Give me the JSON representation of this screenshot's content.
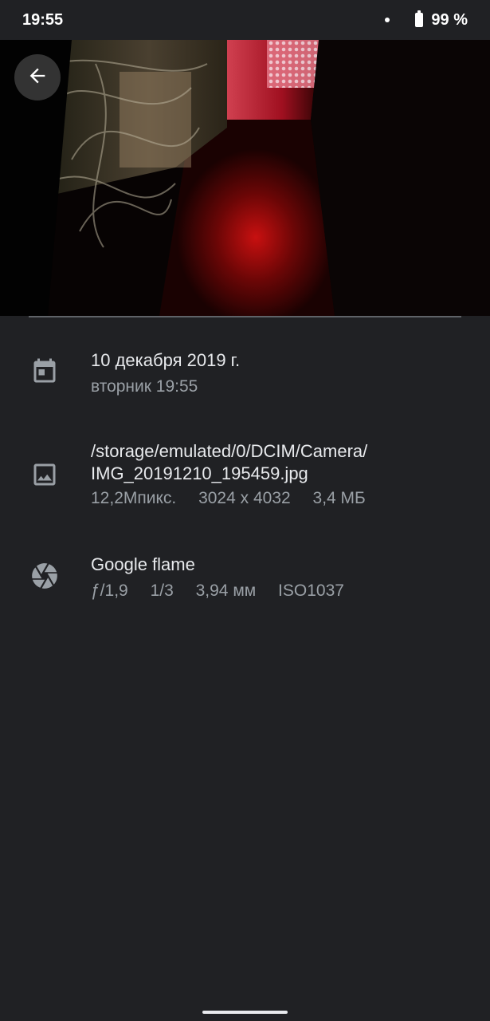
{
  "status_bar": {
    "time": "19:55",
    "battery": "99 %"
  },
  "photo": {
    "description_icon": "photo-preview"
  },
  "details": {
    "date": {
      "title": "10 декабря 2019 г.",
      "subtitle": "вторник 19:55",
      "icon": "calendar-icon"
    },
    "file": {
      "path_line1": "/storage/emulated/0/DCIM/Camera/",
      "path_line2": "IMG_20191210_195459.jpg",
      "megapixels": "12,2Мпикс.",
      "resolution": "3024 x 4032",
      "size": "3,4 МБ",
      "icon": "image-icon"
    },
    "camera": {
      "model": "Google flame",
      "aperture": "ƒ/1,9",
      "shutter": "1/3",
      "focal_length": "3,94 мм",
      "iso": "ISO1037",
      "icon": "aperture-icon"
    }
  },
  "colors": {
    "background": "#202124",
    "text_primary": "#e8eaed",
    "text_secondary": "#9aa0a6"
  }
}
